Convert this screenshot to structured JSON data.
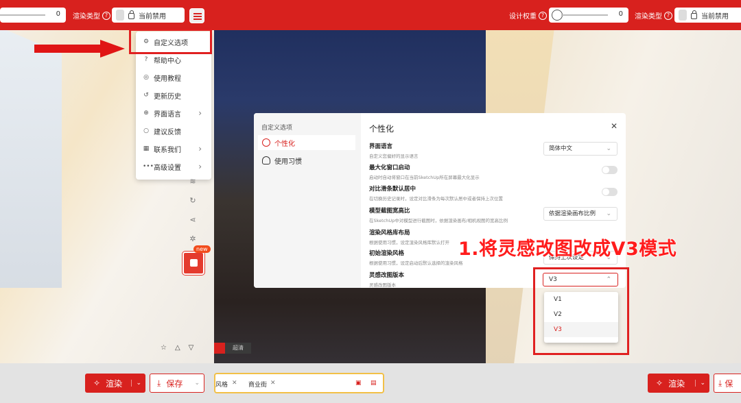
{
  "topbar": {
    "left_slider_value": "0",
    "render_type_label": "渲染类型",
    "mode_value": "当前禁用",
    "design_weight_label": "设计权重",
    "right_slider_value": "0",
    "right_render_type_label": "渲染类型",
    "right_mode_value": "当前禁用"
  },
  "menu": {
    "items": [
      {
        "label": "自定义选项",
        "icon": "gear-icon"
      },
      {
        "label": "帮助中心",
        "icon": "help-icon"
      },
      {
        "label": "使用教程",
        "icon": "bulb-icon"
      },
      {
        "label": "更新历史",
        "icon": "history-icon"
      },
      {
        "label": "界面语言",
        "icon": "globe-icon"
      },
      {
        "label": "建议反馈",
        "icon": "feedback-icon"
      },
      {
        "label": "联系我们",
        "icon": "contact-icon"
      },
      {
        "label": "高级设置",
        "icon": "more-icon"
      }
    ]
  },
  "sidebar_badge": "new",
  "bottom": {
    "render_label": "渲染",
    "save_label": "保存",
    "chip1": "风格",
    "chip2": "商业街",
    "dark_tag": "超清",
    "right_render_label": "渲染",
    "right_save_label": "保"
  },
  "modal": {
    "side_title": "自定义选项",
    "side_items": [
      "个性化",
      "使用习惯"
    ],
    "title": "个性化",
    "close": "✕",
    "settings": [
      {
        "title": "界面语言",
        "desc": "自定义您偏好的显示语言",
        "value": "简体中文"
      },
      {
        "title": "最大化窗口启动",
        "desc": "启动时自动将窗口在当前SketchUp所在屏幕最大化显示"
      },
      {
        "title": "对比滑条默认居中",
        "desc": "在切换历史记录时，设定对比滑条为每次默认居中或者保持上次位置"
      },
      {
        "title": "模型截图宽高比",
        "desc": "在SketchUp中对模型进行截图时，依据渲染画布/相机视图的宽高比例",
        "value": "依据渲染画布比例"
      },
      {
        "title": "渲染风格库布局",
        "desc": "根据使用习惯，设定渲染风格库默认打开"
      },
      {
        "title": "初始渲染风格",
        "desc": "根据使用习惯，设定启动后默认选择的渲染风格",
        "value": "保持上次设定"
      },
      {
        "title": "灵感改图版本",
        "desc": "灵感改图版本"
      }
    ]
  },
  "version": {
    "selected": "V3",
    "options": [
      "V1",
      "V2",
      "V3"
    ]
  },
  "annotation": "1.将灵感改图改成V3模式"
}
